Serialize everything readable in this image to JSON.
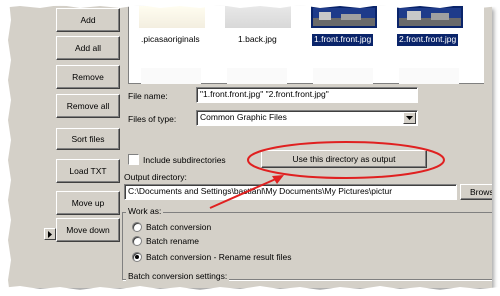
{
  "buttons": {
    "add": "Add",
    "add_all": "Add all",
    "remove": "Remove",
    "remove_all": "Remove all",
    "sort_files": "Sort files",
    "load_txt": "Load TXT",
    "move_up": "Move up",
    "move_down": "Move down",
    "use_directory": "Use this directory as output",
    "browse": "Browse"
  },
  "thumbnails": [
    {
      "label": ".picasaoriginals",
      "selected": false
    },
    {
      "label": "1.back.jpg",
      "selected": false
    },
    {
      "label": "1.front.front.jpg",
      "selected": true
    },
    {
      "label": "2.front.front.jpg",
      "selected": true
    }
  ],
  "file_name": {
    "label": "File name:",
    "value": "\"1.front.front.jpg\" \"2.front.front.jpg\""
  },
  "files_of_type": {
    "label": "Files of type:",
    "value": "Common Graphic Files"
  },
  "include_subdirectories": {
    "label": "Include subdirectories",
    "checked": false
  },
  "output_directory": {
    "label": "Output directory:",
    "value": "C:\\Documents and Settings\\bastianl\\My Documents\\My Pictures\\pictur"
  },
  "work_as": {
    "title": "Work as:",
    "options": [
      {
        "label": "Batch conversion",
        "checked": false
      },
      {
        "label": "Batch rename",
        "checked": false
      },
      {
        "label": "Batch conversion - Rename result files",
        "checked": true
      }
    ]
  },
  "batch_settings": {
    "title": "Batch conversion settings:"
  },
  "colors": {
    "face": "#d4d0c8",
    "selection": "#0a246a",
    "annotation": "#e02020"
  }
}
